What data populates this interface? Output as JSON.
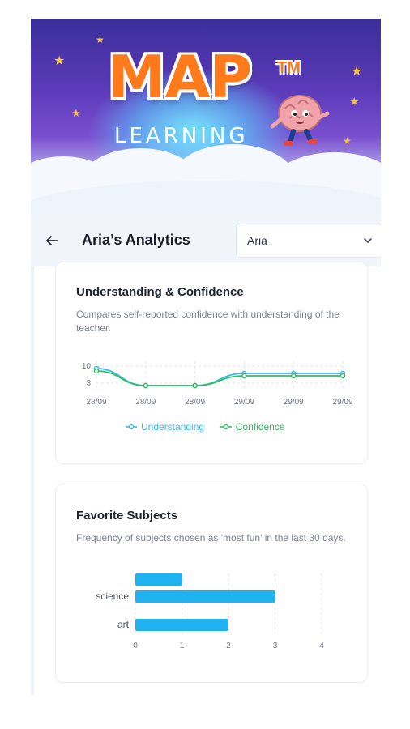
{
  "banner": {
    "logo_title": "MAP",
    "logo_tm": "TM",
    "logo_subtitle": "LEARNING"
  },
  "header": {
    "back_icon": "arrow-left-icon",
    "title": "Aria’s Analytics",
    "student_select": {
      "value": "Aria",
      "icon": "chevron-down-icon"
    }
  },
  "understanding_card": {
    "title": "Understanding & Confidence",
    "description": "Compares self-reported confidence with understanding of the teacher."
  },
  "subjects_card": {
    "title": "Favorite Subjects",
    "description": "Frequency of subjects chosen as 'most fun' in the last 30 days."
  },
  "chart_data": [
    {
      "type": "line",
      "x": [
        "28/09",
        "28/09",
        "28/09",
        "29/09",
        "29/09",
        "29/09"
      ],
      "y_ticks": [
        "10",
        "3"
      ],
      "ylim": [
        0,
        12
      ],
      "grid": true,
      "legend_position": "bottom",
      "series": [
        {
          "name": "Understanding",
          "color": "#3bb6f2",
          "values": [
            9,
            2,
            2,
            7,
            7,
            7
          ]
        },
        {
          "name": "Confidence",
          "color": "#2ebd5f",
          "values": [
            8,
            2,
            2,
            6,
            6,
            6
          ]
        }
      ]
    },
    {
      "type": "bar",
      "orientation": "horizontal",
      "categories": [
        "",
        "science",
        "art"
      ],
      "values": [
        1,
        3,
        2
      ],
      "x_ticks": [
        "0",
        "1",
        "2",
        "3",
        "4"
      ],
      "xlim": [
        0,
        4
      ],
      "grid": true,
      "color": "#1eb3f0"
    }
  ]
}
